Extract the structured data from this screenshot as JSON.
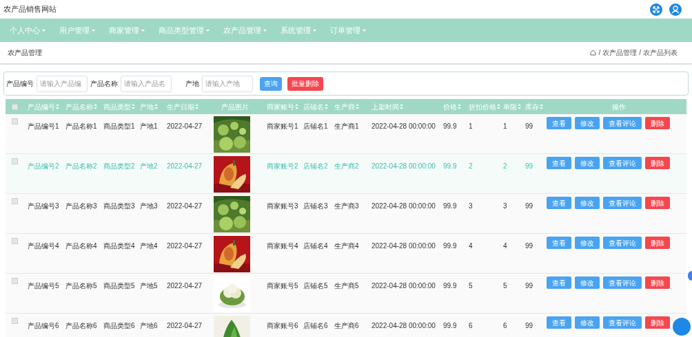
{
  "site_title": "农产品销售网站",
  "nav": [
    {
      "label": "个人中心"
    },
    {
      "label": "用户管理"
    },
    {
      "label": "商家管理"
    },
    {
      "label": "商品类型管理"
    },
    {
      "label": "农产品管理"
    },
    {
      "label": "系统管理"
    },
    {
      "label": "订单管理"
    }
  ],
  "page_title": "农产品管理",
  "breadcrumb": [
    {
      "separator": "/",
      "label": "农产品管理"
    },
    {
      "separator": "/",
      "label": "农产品列表"
    }
  ],
  "search": {
    "fields": [
      {
        "label": "产品编号",
        "placeholder": "请输入产品编"
      },
      {
        "label": "产品名称",
        "placeholder": "请输入产品名"
      },
      {
        "label": "产地",
        "placeholder": "请输入产地"
      }
    ],
    "query_button": "查询",
    "batch_delete_button": "批量删除"
  },
  "table": {
    "select_all_checked": false,
    "columns": [
      {
        "label": "产品编号",
        "sortable": true
      },
      {
        "label": "产品名称",
        "sortable": true
      },
      {
        "label": "商品类型",
        "sortable": true
      },
      {
        "label": "产地",
        "sortable": true
      },
      {
        "label": "生产日期",
        "sortable": true
      },
      {
        "label": "产品图片",
        "sortable": false
      },
      {
        "label": "商家账号",
        "sortable": true
      },
      {
        "label": "店铺名",
        "sortable": true
      },
      {
        "label": "生产商",
        "sortable": true
      },
      {
        "label": "上架时间",
        "sortable": true
      },
      {
        "label": "价格",
        "sortable": true
      },
      {
        "label": "折扣价格",
        "sortable": true
      },
      {
        "label": "单限",
        "sortable": true
      },
      {
        "label": "库存",
        "sortable": true
      },
      {
        "label": "操作",
        "sortable": false
      }
    ],
    "rows": [
      {
        "checked": false,
        "highlighted": false,
        "cells": [
          "产品编号1",
          "产品名称1",
          "商品类型1",
          "产地1",
          "2022-04-27",
          {
            "kind": "picture"
          },
          "商家账号1",
          "店铺名1",
          "生产商1",
          "2022-04-28 00:00:00",
          "99.9",
          "1",
          "1",
          "99"
        ],
        "actions": [
          {
            "label": "查看",
            "kind": "primary"
          },
          {
            "label": "修改",
            "kind": "primary"
          },
          {
            "label": "查看评论",
            "kind": "primary"
          },
          {
            "label": "删除",
            "kind": "danger"
          }
        ]
      },
      {
        "checked": false,
        "highlighted": true,
        "cells": [
          "产品编号2",
          "产品名称2",
          "商品类型2",
          "产地2",
          "2022-04-27",
          {
            "kind": "picture"
          },
          "商家账号2",
          "店铺名2",
          "生产商2",
          "2022-04-28 00:00:00",
          "99.9",
          "2",
          "2",
          "99"
        ],
        "actions": [
          {
            "label": "查看",
            "kind": "primary"
          },
          {
            "label": "修改",
            "kind": "primary"
          },
          {
            "label": "查看评论",
            "kind": "primary"
          },
          {
            "label": "删除",
            "kind": "danger"
          }
        ]
      },
      {
        "checked": false,
        "highlighted": false,
        "cells": [
          "产品编号3",
          "产品名称3",
          "商品类型3",
          "产地3",
          "2022-04-27",
          {
            "kind": "picture"
          },
          "商家账号3",
          "店铺名3",
          "生产商3",
          "2022-04-28 00:00:00",
          "99.9",
          "3",
          "3",
          "99"
        ],
        "actions": [
          {
            "label": "查看",
            "kind": "primary"
          },
          {
            "label": "修改",
            "kind": "primary"
          },
          {
            "label": "查看评论",
            "kind": "primary"
          },
          {
            "label": "删除",
            "kind": "danger"
          }
        ]
      },
      {
        "checked": false,
        "highlighted": false,
        "cells": [
          "产品编号4",
          "产品名称4",
          "商品类型4",
          "产地4",
          "2022-04-27",
          {
            "kind": "picture"
          },
          "商家账号4",
          "店铺名4",
          "生产商4",
          "2022-04-28 00:00:00",
          "99.9",
          "4",
          "4",
          "99"
        ],
        "actions": [
          {
            "label": "查看",
            "kind": "primary"
          },
          {
            "label": "修改",
            "kind": "primary"
          },
          {
            "label": "查看评论",
            "kind": "primary"
          },
          {
            "label": "删除",
            "kind": "danger"
          }
        ]
      },
      {
        "checked": false,
        "highlighted": false,
        "cells": [
          "产品编号5",
          "产品名称5",
          "商品类型5",
          "产地5",
          "2022-04-27",
          {
            "kind": "picture"
          },
          "商家账号5",
          "店铺名5",
          "生产商5",
          "2022-04-28 00:00:00",
          "99.9",
          "5",
          "5",
          "99"
        ],
        "actions": [
          {
            "label": "查看",
            "kind": "primary"
          },
          {
            "label": "修改",
            "kind": "primary"
          },
          {
            "label": "查看评论",
            "kind": "primary"
          },
          {
            "label": "删除",
            "kind": "danger"
          }
        ]
      },
      {
        "checked": false,
        "highlighted": false,
        "cells": [
          "产品编号6",
          "产品名称6",
          "商品类型6",
          "产地6",
          "2022-04-27",
          {
            "kind": "picture"
          },
          "商家账号6",
          "店铺名6",
          "生产商6",
          "2022-04-28 00:00:00",
          "99.9",
          "6",
          "6",
          "99"
        ],
        "actions": [
          {
            "label": "查看",
            "kind": "primary"
          },
          {
            "label": "修改",
            "kind": "primary"
          },
          {
            "label": "查看评论",
            "kind": "primary"
          },
          {
            "label": "删除",
            "kind": "danger"
          }
        ]
      }
    ]
  }
}
